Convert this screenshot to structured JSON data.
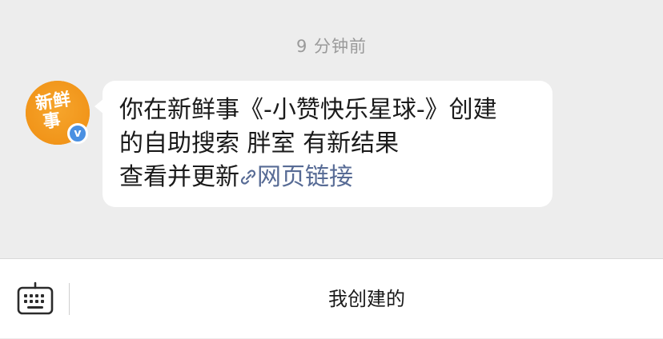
{
  "chat": {
    "timestamp": "9 分钟前",
    "avatar": {
      "line1": "新鲜",
      "line2": "事",
      "badge": "v"
    },
    "message": {
      "line1": "你在新鲜事《-小赞快乐星球-》创建",
      "line2": "的自助搜索 胖室 有新结果",
      "line3_prefix": "查看并更新",
      "link_text": "网页链接"
    }
  },
  "bottom_bar": {
    "menu_label": "我创建的"
  },
  "icons": {
    "link": "link-icon",
    "keyboard": "keyboard-icon"
  },
  "colors": {
    "background": "#ededed",
    "avatar": "#f39a1c",
    "badge": "#4a90e2",
    "link": "#576b95"
  }
}
